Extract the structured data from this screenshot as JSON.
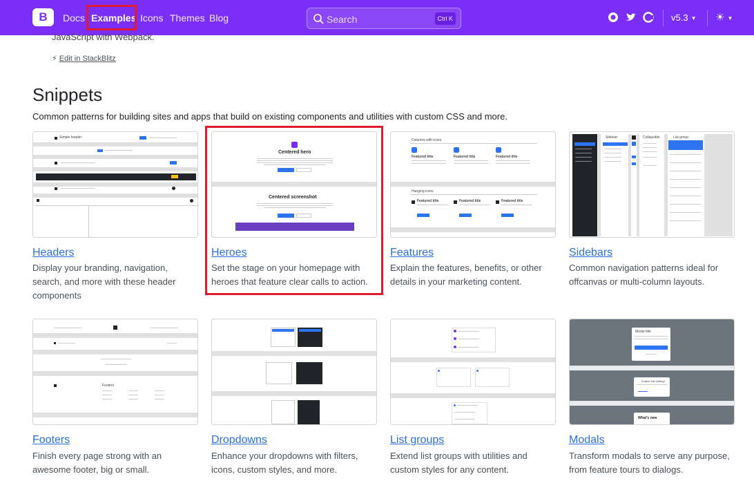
{
  "nav": {
    "brand_letter": "B",
    "links": [
      "Docs",
      "Examples",
      "Icons",
      "Themes",
      "Blog"
    ],
    "active": "Examples",
    "search_placeholder": "Search",
    "search_shortcut": "Ctrl K",
    "version": "v5.3",
    "colors": {
      "bg": "#7a2ef6",
      "highlight": "#e01c2c"
    }
  },
  "intro": {
    "trailing_text": "JavaScript with Webpack.",
    "stackblitz_link": "Edit in StackBlitz"
  },
  "section": {
    "title": "Snippets",
    "lead": "Common patterns for building sites and apps that build on existing components and utilities with custom CSS and more."
  },
  "cards": [
    {
      "title": "Headers",
      "desc": "Display your branding, navigation, search, and more with these header components"
    },
    {
      "title": "Heroes",
      "desc": "Set the stage on your homepage with heroes that feature clear calls to action."
    },
    {
      "title": "Features",
      "desc": "Explain the features, benefits, or other details in your marketing content."
    },
    {
      "title": "Sidebars",
      "desc": "Common navigation patterns ideal for offcanvas or multi-column layouts."
    },
    {
      "title": "Footers",
      "desc": "Finish every page strong with an awesome footer, big or small."
    },
    {
      "title": "Dropdowns",
      "desc": "Enhance your dropdowns with filters, icons, custom styles, and more."
    },
    {
      "title": "List groups",
      "desc": "Extend list groups with utilities and custom styles for any content."
    },
    {
      "title": "Modals",
      "desc": "Transform modals to serve any purpose, from feature tours to dialogs."
    }
  ],
  "thumbs": {
    "hero_title": "Centered hero",
    "hero_title2": "Centered screenshot",
    "features_title": "Columns with icons",
    "features_item": "Featured title",
    "features_title2": "Hanging icons",
    "sidebar_title": "Sidebar",
    "sidebar_title2": "Collapsible",
    "sidebar_title3": "List group",
    "header_brand": "Simple header",
    "modal_title": "Modal title",
    "modal_title2": "Enable this setting?",
    "modal_title3": "What's new"
  }
}
